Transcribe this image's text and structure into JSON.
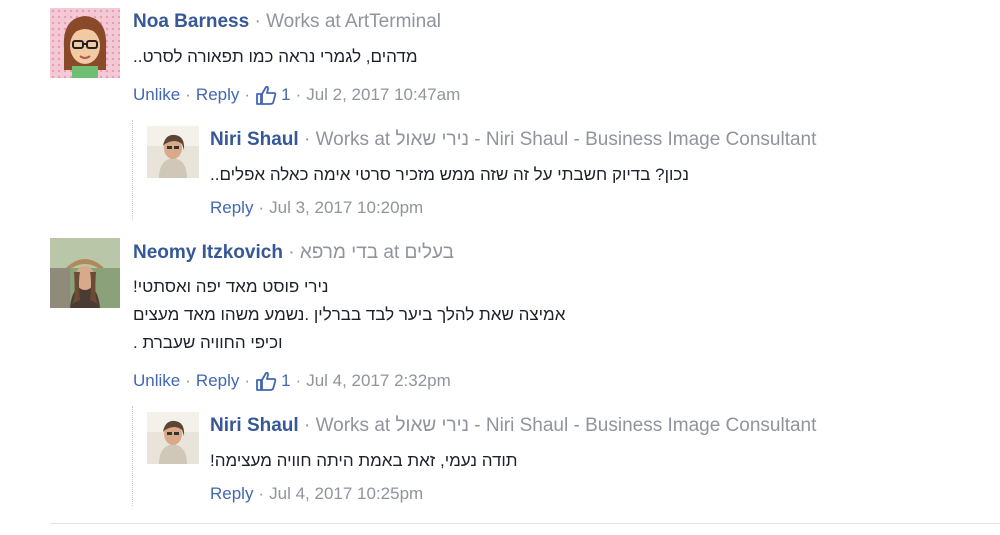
{
  "comments": [
    {
      "author": "Noa Barness",
      "sep": "·",
      "work": "Works at ArtTerminal",
      "text": "..מדהים, לגמרי נראה כמו תפאורה לסרט",
      "unlike": "Unlike",
      "reply": "Reply",
      "likes": "1",
      "time": "Jul 2, 2017 10:47am"
    },
    {
      "author": "Niri Shaul",
      "sep": "·",
      "work": "Works at נירי שאול - Niri Shaul - Business Image Consultant",
      "text": "..נכון? בדיוק חשבתי על זה שזה ממש מזכיר סרטי אימה כאלה אפלים",
      "reply": "Reply",
      "time": "Jul 3, 2017 10:20pm"
    },
    {
      "author": "Neomy Itzkovich",
      "sep": "·",
      "work": "בדי מרפא at בעלים",
      "text_lines": [
        "!נירי פוסט מאד יפה ואסתטי",
        "אמיצה שאת להלך ביער לבד בברלין .נשמע משהו מאד מעצים",
        ". וכיפי החוויה שעברת"
      ],
      "unlike": "Unlike",
      "reply": "Reply",
      "likes": "1",
      "time": "Jul 4, 2017 2:32pm"
    },
    {
      "author": "Niri Shaul",
      "sep": "·",
      "work": "Works at נירי שאול - Niri Shaul - Business Image Consultant",
      "text": "!תודה נעמי, זאת באמת היתה חוויה מעצימה",
      "reply": "Reply",
      "time": "Jul 4, 2017 10:25pm"
    }
  ],
  "icons": {
    "like": "thumbs-up-icon"
  },
  "colors": {
    "name": "#365899",
    "link": "#4267b2",
    "meta": "#90949c"
  }
}
